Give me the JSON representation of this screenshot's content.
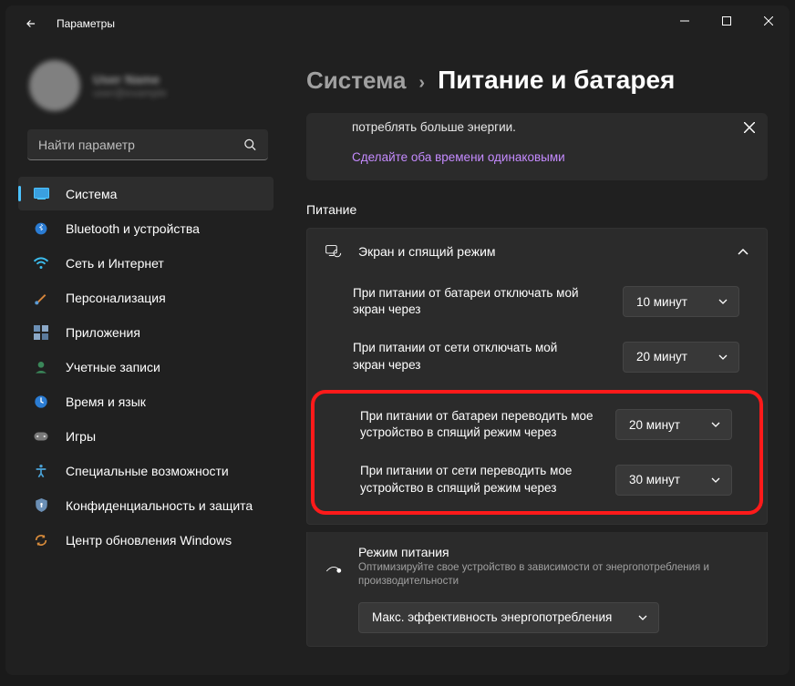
{
  "window": {
    "title": "Параметры"
  },
  "profile": {
    "name": "User Name",
    "email": "user@example"
  },
  "search": {
    "placeholder": "Найти параметр"
  },
  "sidebar": {
    "items": [
      {
        "label": "Система"
      },
      {
        "label": "Bluetooth и устройства"
      },
      {
        "label": "Сеть и Интернет"
      },
      {
        "label": "Персонализация"
      },
      {
        "label": "Приложения"
      },
      {
        "label": "Учетные записи"
      },
      {
        "label": "Время и язык"
      },
      {
        "label": "Игры"
      },
      {
        "label": "Специальные возможности"
      },
      {
        "label": "Конфиденциальность и защита"
      },
      {
        "label": "Центр обновления Windows"
      }
    ]
  },
  "breadcrumb": {
    "parent": "Система",
    "current": "Питание и батарея"
  },
  "tip": {
    "text": "потреблять больше энергии.",
    "link": "Сделайте оба времени одинаковыми"
  },
  "section": {
    "title": "Питание"
  },
  "screenSleep": {
    "header": "Экран и спящий режим",
    "rows": [
      {
        "label": "При питании от батареи отключать мой экран через",
        "value": "10 минут"
      },
      {
        "label": "При питании от сети отключать мой экран через",
        "value": "20 минут"
      },
      {
        "label": "При питании от батареи переводить мое устройство в спящий режим через",
        "value": "20 минут"
      },
      {
        "label": "При питании от сети переводить мое устройство в спящий режим через",
        "value": "30 минут"
      }
    ]
  },
  "powerMode": {
    "title": "Режим питания",
    "desc": "Оптимизируйте свое устройство в зависимости от энергопотребления и производительности",
    "value": "Макс. эффективность энергопотребления"
  },
  "colors": {
    "accent": "#4cc2ff",
    "highlight": "#ff1a1a"
  }
}
